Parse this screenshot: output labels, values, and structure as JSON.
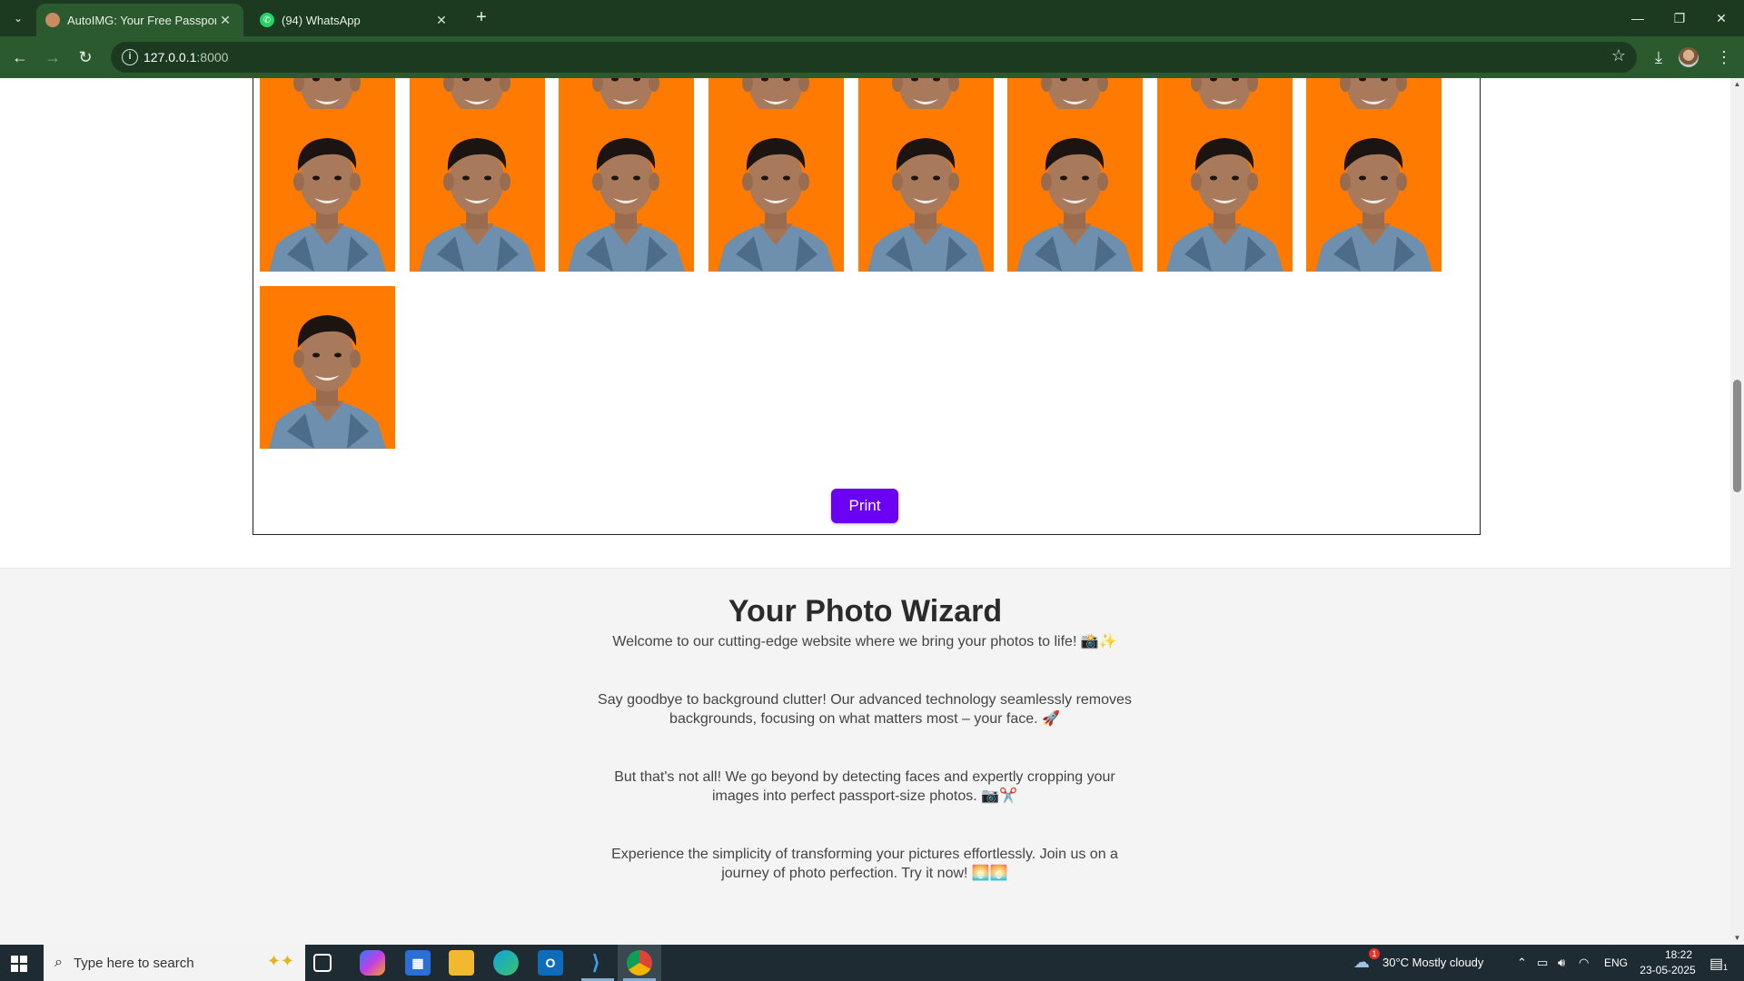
{
  "browser": {
    "tabs": [
      {
        "title": "AutoIMG: Your Free Passport to",
        "active": true
      },
      {
        "title": "(94) WhatsApp",
        "active": false
      }
    ],
    "address": {
      "host": "127.0.0.1",
      "port": ":8000"
    },
    "icons": [
      "tab-list-icon",
      "new-tab-icon",
      "back-icon",
      "forward-icon",
      "reload-icon",
      "site-info-icon",
      "bookmark-star-icon",
      "download-icon",
      "profile-avatar",
      "menu-icon",
      "minimize-icon",
      "restore-icon",
      "close-icon"
    ]
  },
  "page": {
    "print_label": "Print",
    "photo_count_full_row": 8,
    "photo_count_last_row": 1,
    "photo_background": "#ff7a00",
    "info": {
      "title": "Your Photo Wizard",
      "paragraphs": [
        "Welcome to our cutting-edge website where we bring your photos to life! 📸✨",
        "Say goodbye to background clutter! Our advanced technology seamlessly removes backgrounds, focusing on what matters most – your face. 🚀",
        "But that's not all! We go beyond by detecting faces and expertly cropping your images into perfect passport-size photos. 📷✂️",
        "Experience the simplicity of transforming your pictures effortlessly. Join us on a journey of photo perfection. Try it now! 🌅🌅"
      ]
    }
  },
  "taskbar": {
    "search_placeholder": "Type here to search",
    "weather": "30°C  Mostly cloudy",
    "weather_badge": "1",
    "language": "ENG",
    "time": "18:22",
    "date": "23-05-2025",
    "notification_count": "1"
  },
  "colors": {
    "chrome_dark": "#1b3a1f",
    "chrome_toolbar": "#2c5a2f",
    "print_button": "#6a00f4",
    "info_background": "#f4f4f4"
  }
}
